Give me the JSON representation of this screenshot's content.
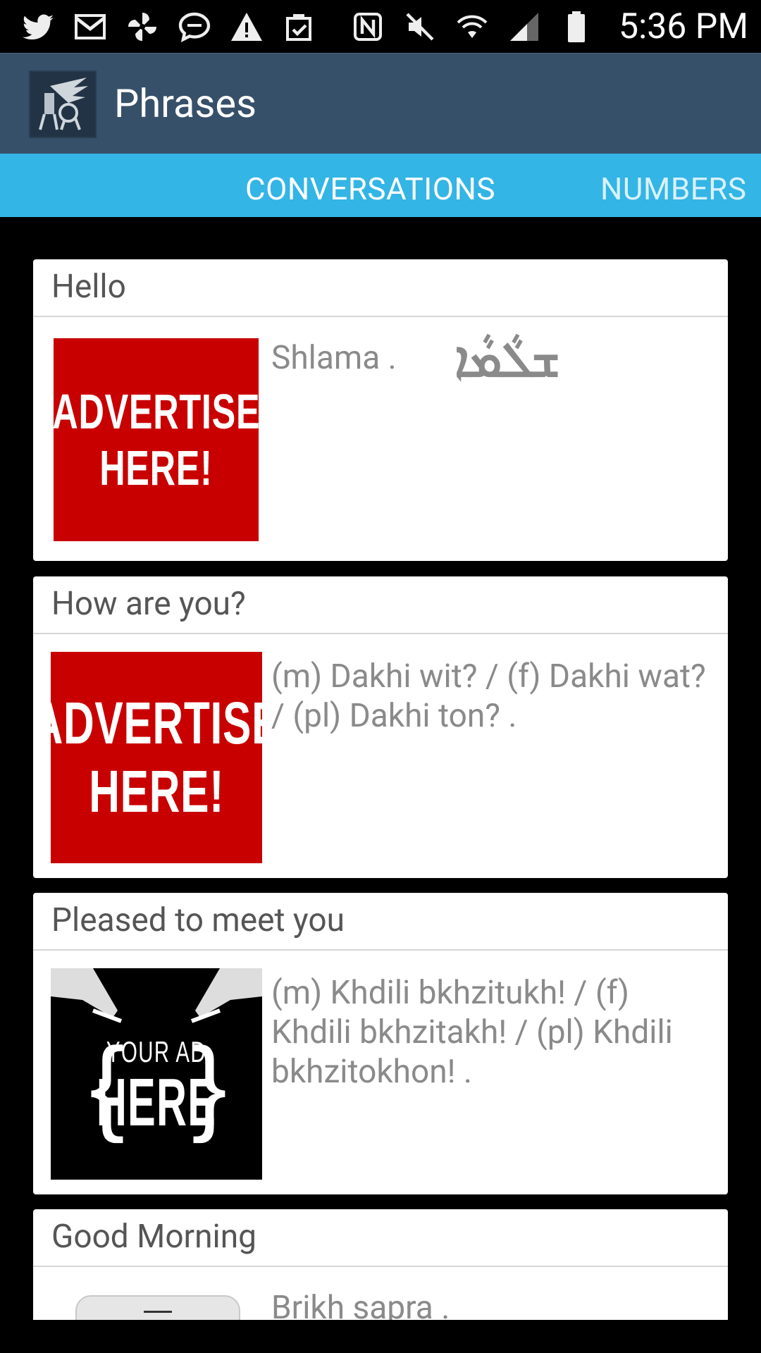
{
  "status_bar": {
    "time": "5:36 PM",
    "left_icons": [
      "twitter-icon",
      "gmail-icon",
      "pinwheel-icon",
      "chat-bubble-icon",
      "warning-icon",
      "clipboard-check-icon"
    ],
    "right_icons": [
      "nfc-icon",
      "mute-icon",
      "wifi-icon",
      "cell-signal-icon",
      "battery-icon"
    ]
  },
  "action_bar": {
    "title": "Phrases",
    "app_icon": "lamassu-logo-icon"
  },
  "tabs": {
    "active": "CONVERSATIONS",
    "next": "NUMBERS"
  },
  "cards": [
    {
      "title": "Hello",
      "phrase": "Shlama .",
      "script": "ܫܠܵܡܵܐ",
      "ad": {
        "line1": "ADVERTISE",
        "line2": "HERE!"
      }
    },
    {
      "title": "How are you?",
      "phrase": "(m) Dakhi wit? / (f) Dakhi wat? / (pl) Dakhi ton? .",
      "ad": {
        "line1": "ADVERTISE",
        "line2": "HERE!"
      }
    },
    {
      "title": "Pleased to meet you",
      "phrase": "(m) Khdili bkhzitukh! / (f) Khdili bkhzitakh! / (pl) Khdili bkhzitokhon! .",
      "ad": {
        "line1": "YOUR AD",
        "line2": "HERE"
      }
    },
    {
      "title": "Good Morning",
      "phrase": "Brikh sapra ."
    }
  ]
}
